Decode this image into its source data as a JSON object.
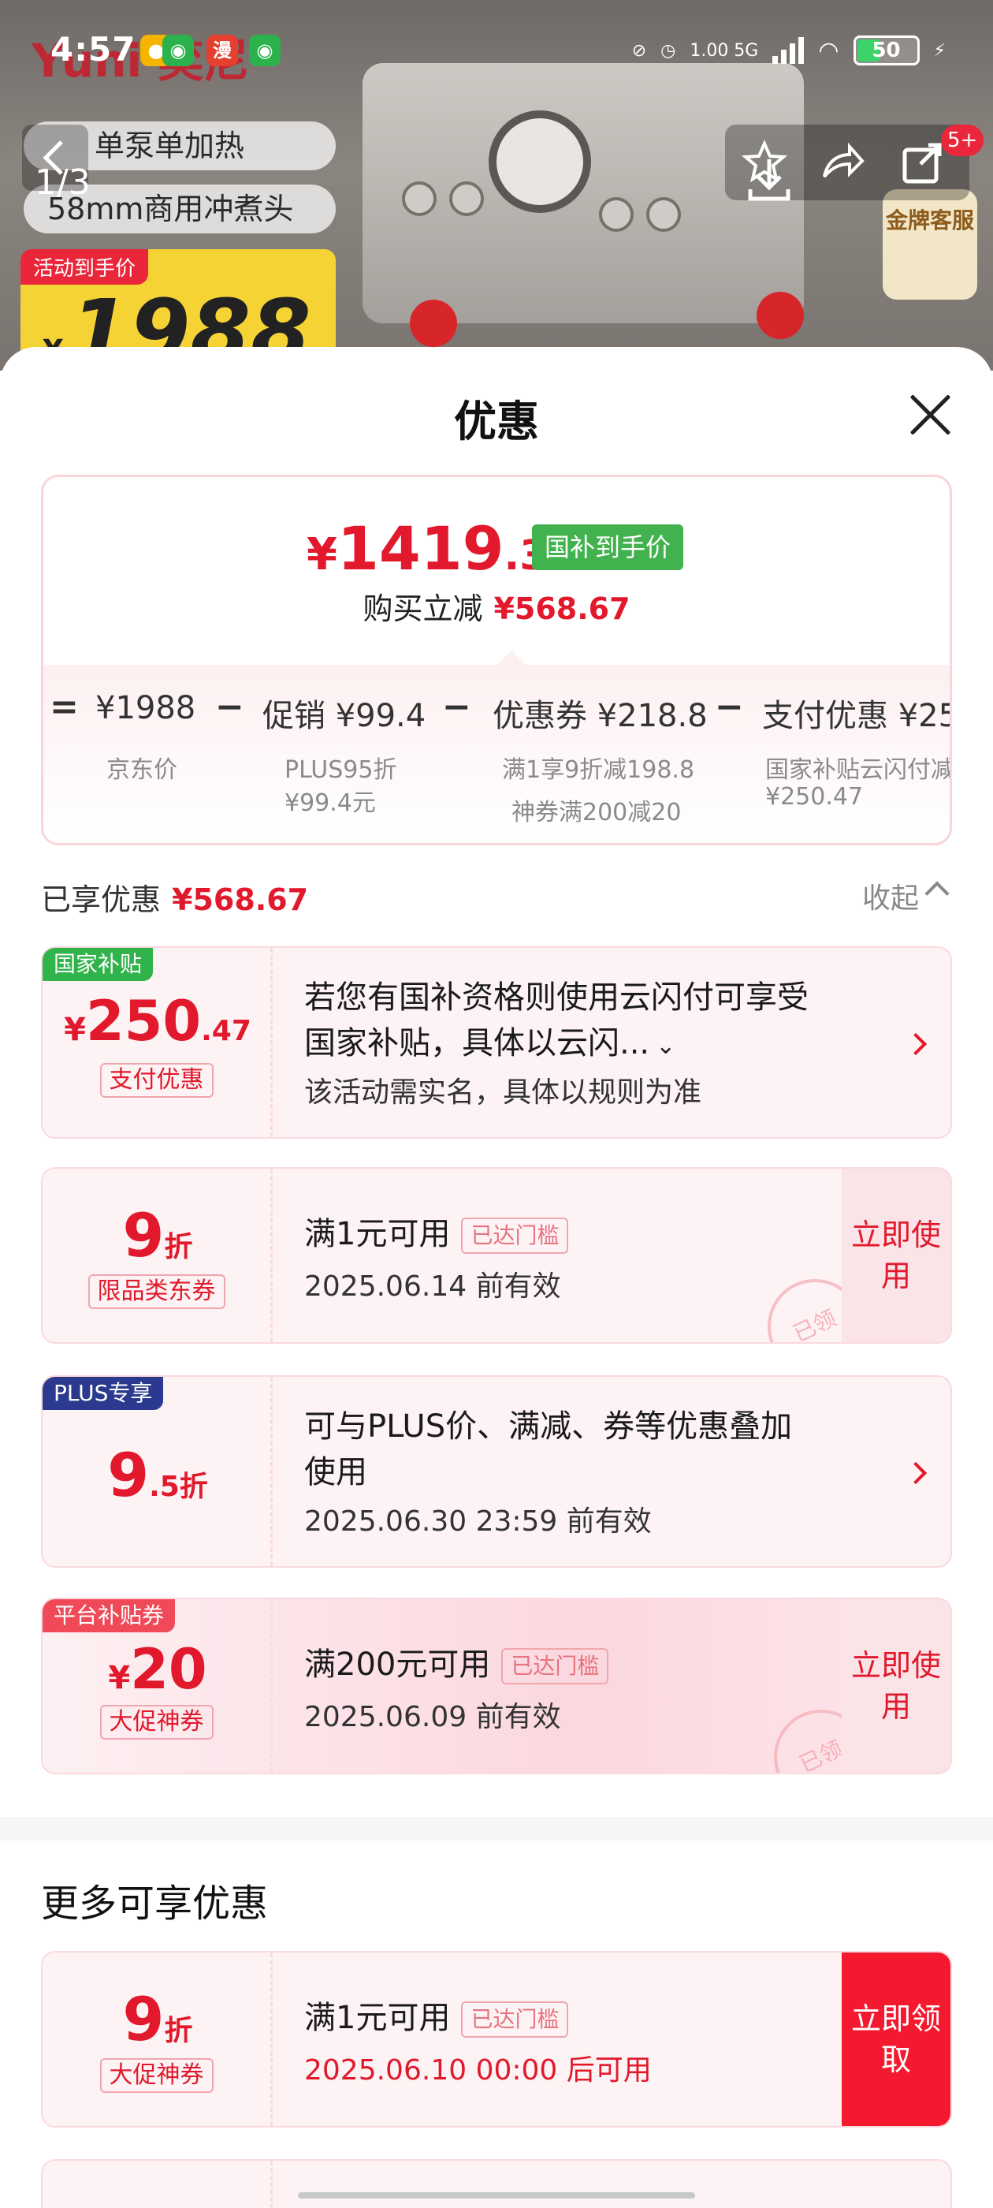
{
  "status": {
    "time": "4:57",
    "signal_text": "1.00 5G",
    "battery": "50"
  },
  "product_bg": {
    "brand": "Yuni 奕尼",
    "promo_line1": "单泵单加热",
    "promo_line2": "58mm商用冲煮头",
    "price_tag": "活动到手价",
    "price_yen": "¥",
    "price": "1988",
    "badge": "金牌客服",
    "image_counter": "1/3",
    "cart_badge": "5+"
  },
  "sheet": {
    "title": "优惠",
    "final_price_yen": "¥",
    "final_price_int": "1419",
    "final_price_dec": ".33",
    "final_price_tag": "国补到手价",
    "reduce_label": "购买立减",
    "reduce_value": "¥568.67",
    "breakdown": [
      {
        "op": "=",
        "label": "¥1988",
        "sub1": "京东价",
        "sub2": ""
      },
      {
        "op": "−",
        "label": "促销 ¥99.4",
        "sub1": "PLUS95折",
        "sub2": "¥99.4元"
      },
      {
        "op": "−",
        "label": "优惠券 ¥218.8",
        "sub1": "满1享9折减198.8",
        "sub2": "神券满200减20"
      },
      {
        "op": "−",
        "label": "支付优惠 ¥25",
        "sub1": "国家补贴云闪付减",
        "sub2": "¥250.47"
      }
    ],
    "enjoyed_label": "已享优惠",
    "enjoyed_value": "¥568.67",
    "collapse_label": "收起"
  },
  "cards": [
    {
      "tag": "国家补贴",
      "tag_color": "#2fb34a",
      "amount_prefix": "¥",
      "amount": "250",
      "amount_suffix": ".47",
      "sub": "支付优惠",
      "line1": "若您有国补资格则使用云闪付可享受",
      "line2": "国家补贴，具体以云闪...",
      "line3": "该活动需实名，具体以规则为准"
    },
    {
      "amount": "9",
      "amount_suffix": "折",
      "sub": "限品类东券",
      "line1": "满1元可用",
      "reached": "已达门槛",
      "date": "2025.06.14 前有效",
      "button": "立即使用",
      "stamp": "已领"
    },
    {
      "tag": "PLUS专享",
      "tag_color": "#2b3a8f",
      "amount": "9",
      "amount_suffix": ".5折",
      "line1": "可与PLUS价、满减、券等优惠叠加",
      "line2": "使用",
      "date": "2025.06.30 23:59 前有效"
    },
    {
      "tag": "平台补贴券",
      "tag_color": "#f04a58",
      "amount_prefix": "¥",
      "amount": "20",
      "sub": "大促神券",
      "line1": "满200元可用",
      "reached": "已达门槛",
      "date": "2025.06.09 前有效",
      "button": "立即使用",
      "stamp": "已领"
    }
  ],
  "more": {
    "title": "更多可享优惠",
    "card": {
      "amount": "9",
      "amount_suffix": "折",
      "sub": "大促神券",
      "line1": "满1元可用",
      "reached": "已达门槛",
      "date": "2025.06.10 00:00 后可用",
      "button": "立即领取"
    }
  }
}
